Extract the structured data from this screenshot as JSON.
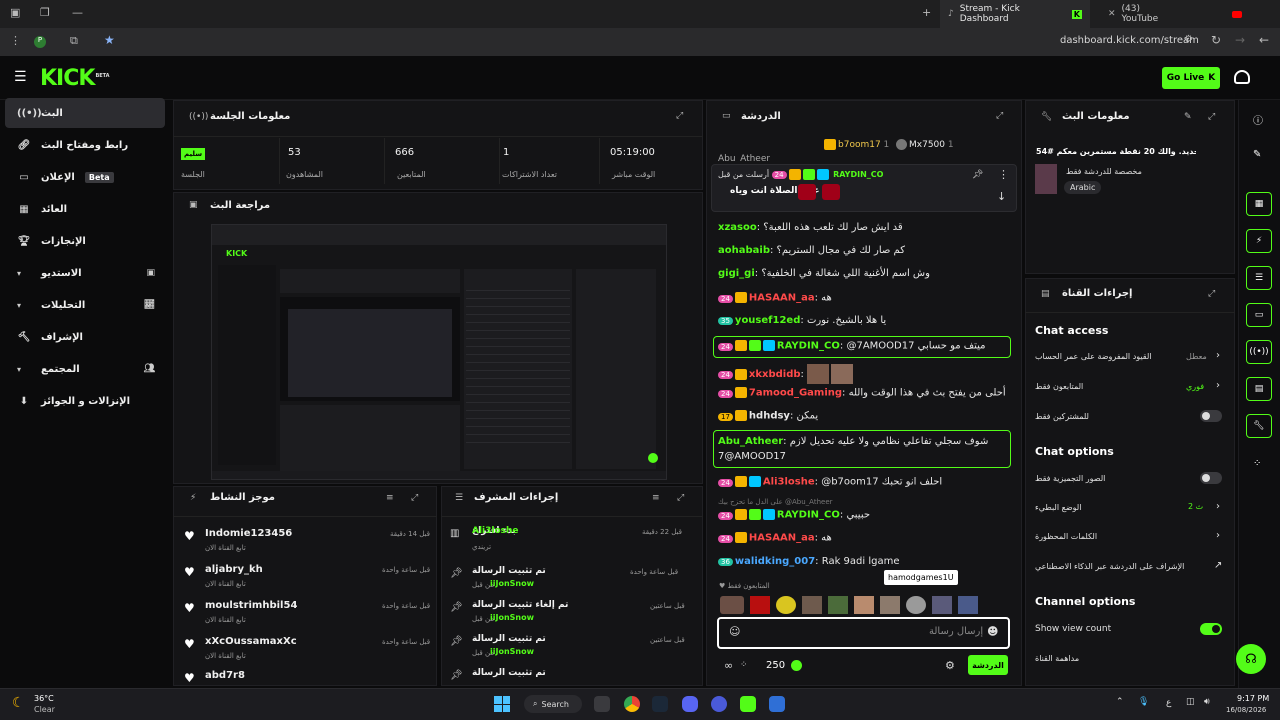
{
  "browser": {
    "tabs": [
      {
        "title": "Stream - Kick Dashboard",
        "active": true
      },
      {
        "title": "(43) YouTube",
        "active": false
      }
    ],
    "url": "dashboard.kick.com/stream"
  },
  "header": {
    "logo": "KICK",
    "logo_tag": "BETA",
    "go_live": "Go Live"
  },
  "sidebar": {
    "items": [
      {
        "label": "البث",
        "icon": "broadcast-icon",
        "selected": true
      },
      {
        "label": "رابط ومفتاح البث",
        "icon": "link-icon"
      },
      {
        "label": "الإعلان",
        "icon": "ad-icon",
        "badge": "Beta"
      },
      {
        "label": "العائد",
        "icon": "revenue-icon"
      },
      {
        "label": "الإنجازات",
        "icon": "trophy-icon"
      },
      {
        "label": "الاستديو",
        "icon": "studio-icon",
        "expandable": true
      },
      {
        "label": "التحليلات",
        "icon": "analytics-icon",
        "expandable": true
      },
      {
        "label": "الإشراف",
        "icon": "moderation-icon"
      },
      {
        "label": "المجتمع",
        "icon": "community-icon",
        "expandable": true
      },
      {
        "label": "الإنزالات و الجوائز",
        "icon": "drops-icon"
      }
    ]
  },
  "session": {
    "title": "معلومات الجلسة",
    "status_badge": "سليم",
    "stats": [
      {
        "value": "05:19:00",
        "label": "الوقت مباشر"
      },
      {
        "value": "1",
        "label": "تعداد الاشتراكات"
      },
      {
        "value": "666",
        "label": "المتابعين"
      },
      {
        "value": "53",
        "label": "المشاهدون"
      },
      {
        "value": "",
        "label": "الجلسة"
      }
    ]
  },
  "preview": {
    "title": "مراجعة البث"
  },
  "activity": {
    "title": "موجز النشاط",
    "items": [
      {
        "name": "Indomie123456",
        "sub": "تابع القناة الان",
        "time": "قبل 14 دقيقة"
      },
      {
        "name": "aljabry_kh",
        "sub": "تابع القناة الان",
        "time": "قبل ساعة واحدة"
      },
      {
        "name": "moulstrimhbil54",
        "sub": "تابع القناة الان",
        "time": "قبل ساعة واحدة"
      },
      {
        "name": "xXcOussamaxXc",
        "sub": "تابع القناة الان",
        "time": "قبل ساعة واحدة"
      },
      {
        "name": "abd7r8",
        "sub": "",
        "time": ""
      }
    ]
  },
  "modactions": {
    "title": "إجراءات المشرف",
    "items": [
      {
        "action": "بدء اقتراع",
        "user": "Ali3loshe",
        "sub": "تريندي",
        "time": "قبل 22 دقيقة"
      },
      {
        "action": "تم تثبيت الرسالة",
        "user": "iiJonSnow",
        "sub": "من قبل",
        "time": "قبل ساعة واحدة"
      },
      {
        "action": "تم إلغاء تثبيت الرسالة",
        "user": "iiJonSnow",
        "sub": "من قبل",
        "time": "قبل ساعتين"
      },
      {
        "action": "تم تثبيت الرسالة",
        "user": "iiJonSnow",
        "sub": "من قبل",
        "time": "قبل ساعتين"
      },
      {
        "action": "تم تثبيت الرسالة",
        "user": "",
        "sub": "",
        "time": ""
      }
    ]
  },
  "chat": {
    "title": "الدردشة",
    "top_gifters": [
      {
        "name": "b7oom17",
        "count": "1"
      },
      {
        "name": "Mx7500",
        "count": "1"
      }
    ],
    "pinned": {
      "by_label": "أرسلت من قبل",
      "user": "RAYDIN_CO",
      "message": "يلا على الصلاة انت وياه"
    },
    "messages": [
      {
        "user": "xzasoo",
        "color": "#53fc18",
        "text": "قد ايش صار لك تلعب هذه اللعبة؟"
      },
      {
        "user": "aohabaib",
        "color": "#53fc18",
        "text": "كم صار لك في مجال الستريم؟"
      },
      {
        "user": "gigi_gi",
        "color": "#53fc18",
        "text": "وش اسم الأغنية اللي شغالة في الخلفية؟"
      },
      {
        "user": "HASAAN_aa",
        "color": "#ff4a4a",
        "text": "هه",
        "sub": "24"
      },
      {
        "user": "yousef12ed",
        "color": "#53fc18",
        "text": "يا هلا بالشيخ. نورت",
        "sub": "35"
      },
      {
        "user": "RAYDIN_CO",
        "color": "#53fc18",
        "text": "@7AMOOD17 ميتف مو حسابي",
        "sub": "24"
      },
      {
        "user": "xkxbdidb",
        "color": "#ff4a4a",
        "text": "",
        "sub": "24"
      },
      {
        "user": "7amood_Gaming",
        "color": "#ff4a4a",
        "text": "أحلى من يفتح بث في هذا الوقت والله",
        "sub": "24"
      },
      {
        "user": "hdhdsy",
        "color": "#e8e8e8",
        "text": "يمكن",
        "sub": "17"
      },
      {
        "user": "Abu_Atheer",
        "color": "#53fc18",
        "text": "شوف سجلي تفاعلي نظامي ولا عليه تحديل لازم 7@AMOOD17"
      },
      {
        "user": "Ali3loshe",
        "color": "#ff4a4a",
        "text": "@b7oom17 احلف انو تحبك",
        "sub": "24"
      },
      {
        "user": "RAYDIN_CO",
        "color": "#53fc18",
        "text": "حبيبي",
        "sub": "24",
        "reply": "على الدل ما تحزح بيك @Abu_Atheer"
      },
      {
        "user": "HASAAN_aa",
        "color": "#ff4a4a",
        "text": "هه",
        "sub": "24"
      },
      {
        "user": "walidking_007",
        "color": "#4aa8ff",
        "text": "Rak 9adi lgame",
        "sub": "36"
      }
    ],
    "tooltip": "hamodgames1U",
    "emote_filter": "المتابعون فقط",
    "input_placeholder": "إرسال رسالة",
    "points": "250",
    "send_button": "الدردشة"
  },
  "stream_info": {
    "title": "معلومات البث",
    "stream_title": "اكتب انا جديد. والك 20 نقطة مستمرين معكم #54",
    "category": "مخصصة للدردشة فقط",
    "language": "Arabic"
  },
  "channel_actions": {
    "title": "إجراءات القناة",
    "chat_access_heading": "Chat access",
    "chat_access": [
      {
        "label": "القيود المفروضة على عمر الحساب",
        "value": "معطل",
        "type": "link"
      },
      {
        "label": "المتابعون فقط",
        "value": "فوري",
        "type": "link"
      },
      {
        "label": "للمشتركين فقط",
        "value": "",
        "type": "toggle",
        "on": false
      }
    ],
    "chat_options_heading": "Chat options",
    "chat_options": [
      {
        "label": "الصور التجميزية فقط",
        "value": "",
        "type": "toggle",
        "on": false
      },
      {
        "label": "الوضع البطيء",
        "value": "2 ث",
        "type": "link"
      },
      {
        "label": "الكلمات المحظورة",
        "value": "",
        "type": "link"
      },
      {
        "label": "الإشراف على الدردشة عبر الذكاء الاصطناعي",
        "value": "",
        "type": "external"
      }
    ],
    "channel_options_heading": "Channel options",
    "channel_options": [
      {
        "label": "Show view count",
        "type": "toggle",
        "on": true
      },
      {
        "label": "مداهمة القناة",
        "type": "link"
      }
    ]
  },
  "taskbar": {
    "weather_temp": "36°C",
    "weather_text": "Clear",
    "search": "Search",
    "time": "9:17 PM",
    "date": "16/08/2026"
  },
  "colors": {
    "accent": "#53fc18",
    "bg": "#0b0b0c",
    "panel": "#141416"
  }
}
